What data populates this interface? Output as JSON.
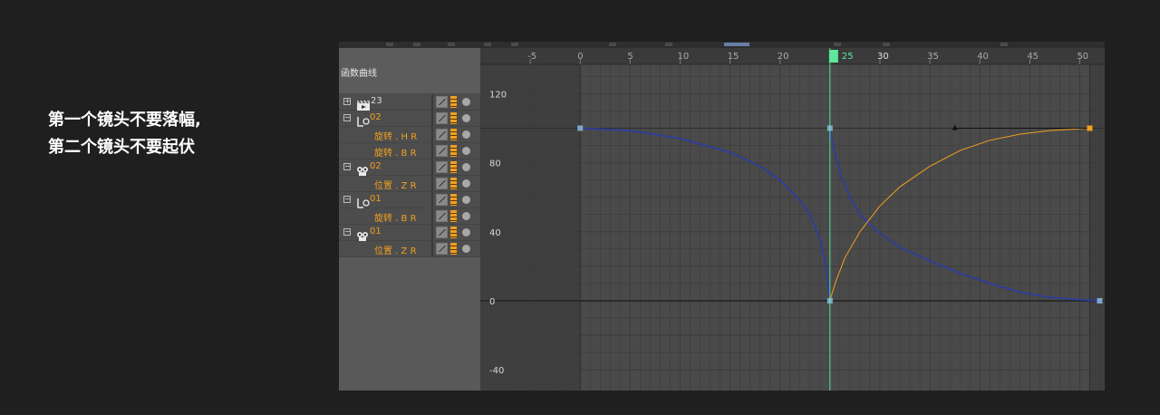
{
  "note": {
    "line1": "第一个镜头不要落幅,",
    "line2": "第二个镜头不要起伏"
  },
  "panel": {
    "title": "函数曲线"
  },
  "tracks": [
    {
      "kind": "object",
      "icon": "clapper-icon",
      "expand": "+",
      "label": "23",
      "color": "white"
    },
    {
      "kind": "object",
      "icon": "null-object-icon",
      "expand": "−",
      "label": "02",
      "color": "orange"
    },
    {
      "kind": "param",
      "label": "旋转 . H  R"
    },
    {
      "kind": "param",
      "label": "旋转 . B  R"
    },
    {
      "kind": "object",
      "icon": "camera-icon",
      "expand": "−",
      "label": "02",
      "color": "orange"
    },
    {
      "kind": "param",
      "label": "位置 . Z  R"
    },
    {
      "kind": "object",
      "icon": "null-object-icon",
      "expand": "−",
      "label": "01",
      "color": "orange"
    },
    {
      "kind": "param",
      "label": "旋转 . B  R"
    },
    {
      "kind": "object",
      "icon": "camera-icon",
      "expand": "−",
      "label": "01",
      "color": "orange"
    },
    {
      "kind": "param",
      "label": "位置 . Z  R"
    }
  ],
  "graph": {
    "x_min": -10,
    "x_max": 52.5,
    "y_min": -52,
    "y_max": 137,
    "x_ticks": [
      "-5",
      "0",
      "5",
      "10",
      "15",
      "20",
      "25",
      "30",
      "35",
      "40",
      "45",
      "50"
    ],
    "y_ticks": [
      "120",
      "80",
      "40",
      "0",
      "-40"
    ],
    "current_frame": 25,
    "current_frame_label": "25",
    "range_start": 0,
    "range_end": 51,
    "colors": {
      "background": "#4a4a4a",
      "grid": "#3c3c3c",
      "playhead": "#5ee89c",
      "curve_blue": "#2e3d9e",
      "curve_orange": "#f0a020",
      "key_blue": "#7fa6c9",
      "key_orange": "#f0a020"
    },
    "curves": [
      {
        "color": "curve_blue",
        "points": [
          [
            0,
            100
          ],
          [
            5,
            98.6
          ],
          [
            10,
            94
          ],
          [
            15,
            86
          ],
          [
            18,
            78
          ],
          [
            20,
            70
          ],
          [
            22,
            58
          ],
          [
            23,
            50
          ],
          [
            24,
            36
          ],
          [
            24.6,
            20
          ],
          [
            24.9,
            6
          ],
          [
            25,
            0
          ]
        ]
      },
      {
        "color": "curve_blue",
        "points": [
          [
            25,
            100
          ],
          [
            25.3,
            90
          ],
          [
            26,
            74
          ],
          [
            27,
            60
          ],
          [
            28,
            50
          ],
          [
            30,
            39
          ],
          [
            32,
            31
          ],
          [
            35,
            23
          ],
          [
            38,
            16
          ],
          [
            41,
            10
          ],
          [
            44,
            5
          ],
          [
            47,
            2
          ],
          [
            49,
            1
          ],
          [
            52,
            0
          ]
        ]
      },
      {
        "color": "curve_orange",
        "points": [
          [
            25,
            0
          ],
          [
            25.5,
            10
          ],
          [
            26.5,
            25
          ],
          [
            28,
            40
          ],
          [
            30,
            55
          ],
          [
            32,
            66
          ],
          [
            35,
            78
          ],
          [
            38,
            87
          ],
          [
            41,
            93
          ],
          [
            44,
            96.5
          ],
          [
            47,
            98.6
          ],
          [
            51,
            100
          ]
        ]
      }
    ],
    "keys": [
      {
        "x": 0,
        "y": 100,
        "color": "key_blue"
      },
      {
        "x": 25,
        "y": 100,
        "color": "key_blue"
      },
      {
        "x": 25,
        "y": 0,
        "color": "key_blue"
      },
      {
        "x": 52,
        "y": 0,
        "color": "key_blue"
      },
      {
        "x": 51,
        "y": 100,
        "color": "key_orange"
      }
    ],
    "tangent_handle": {
      "x1": 37.5,
      "y1": 100,
      "x2": 51,
      "y2": 100
    }
  }
}
